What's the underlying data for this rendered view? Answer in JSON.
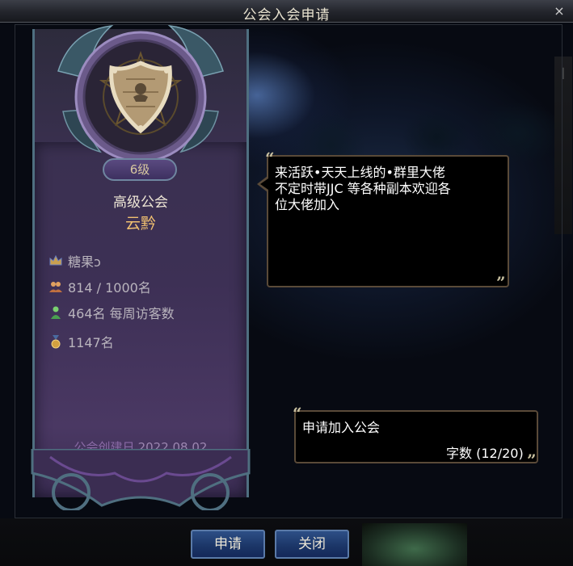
{
  "window": {
    "title": "公会入会申请",
    "close_label": "×"
  },
  "guild": {
    "level_badge": "6级",
    "rank": "高级公会",
    "name": "云黔",
    "leader": "糖果ͻ",
    "members": "814 / 1000名",
    "weekly_visitors": "464名 每周访客数",
    "rank_position": "1147名",
    "created_label": "公会创建日",
    "created_date": "2022.08.02"
  },
  "announcement": {
    "text": "来活跃•天天上线的•群里大佬\n不定时带JJC 等各种副本欢迎各\n位大佬加入",
    "quote_open": "“",
    "quote_close": "”"
  },
  "application": {
    "text": "申请加入公会",
    "char_count": "字数 (12/20)"
  },
  "buttons": {
    "apply": "申请",
    "close": "关闭"
  },
  "icons": {
    "leader": "crown-icon",
    "members": "people-icon",
    "visitors": "person-icon",
    "rank": "medal-icon",
    "emblem": "shield-emblem-icon"
  },
  "colors": {
    "title_text": "#e8e2cf",
    "guild_name": "#f1c070",
    "panel_purple": "#3d3055",
    "button_blue": "#1b3566",
    "created_purple": "#8a6aa6"
  }
}
